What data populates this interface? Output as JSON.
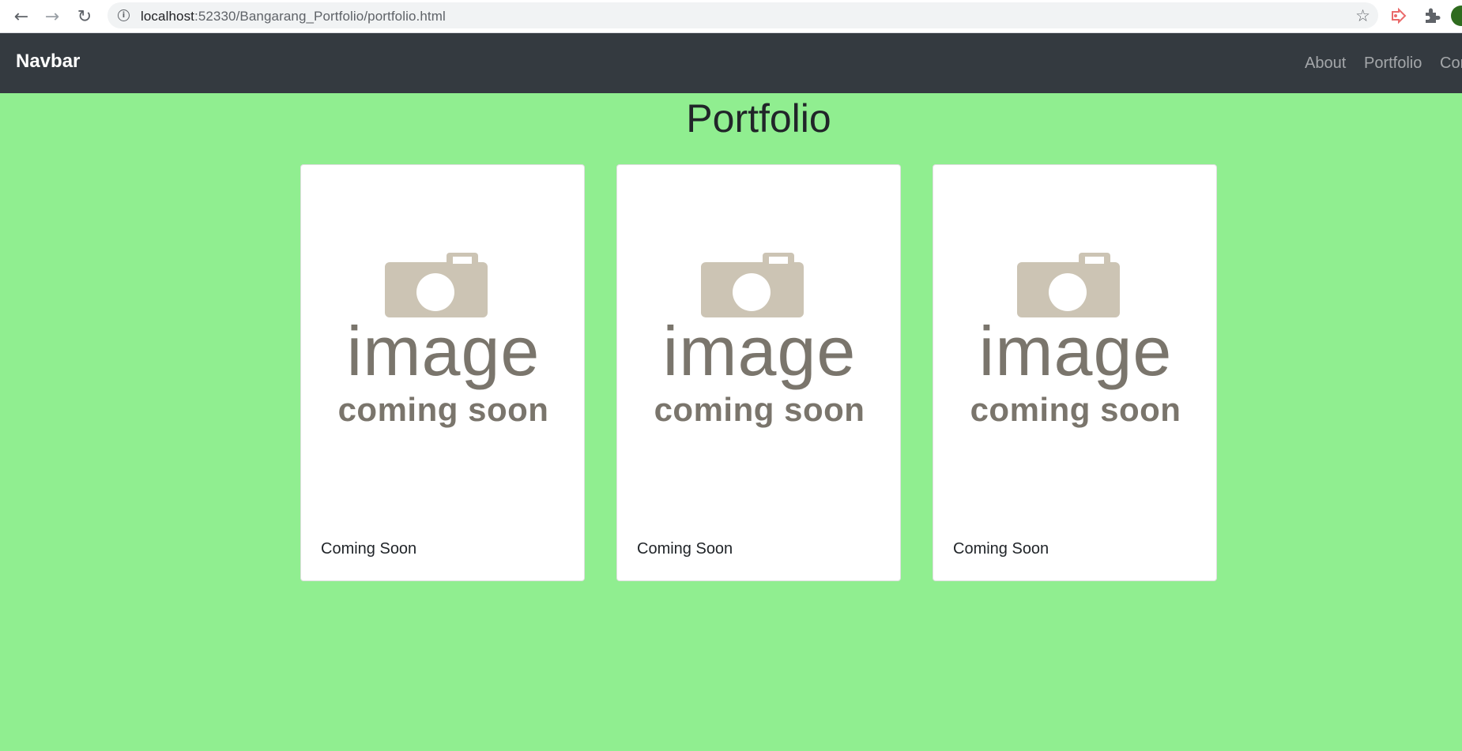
{
  "browser": {
    "url_host": "localhost",
    "url_rest": ":52330/Bangarang_Portfolio/portfolio.html"
  },
  "navbar": {
    "brand": "Navbar",
    "links": [
      "About",
      "Portfolio",
      "Contact"
    ]
  },
  "page": {
    "title": "Portfolio"
  },
  "cards": [
    {
      "image_text_1": "image",
      "image_text_2": "coming soon",
      "caption": "Coming Soon"
    },
    {
      "image_text_1": "image",
      "image_text_2": "coming soon",
      "caption": "Coming Soon"
    },
    {
      "image_text_1": "image",
      "image_text_2": "coming soon",
      "caption": "Coming Soon"
    }
  ],
  "colors": {
    "page_background": "#90ee90",
    "navbar_background": "#343a40",
    "placeholder_gray": "#7a756c",
    "camera_tan": "#ccc4b4"
  }
}
